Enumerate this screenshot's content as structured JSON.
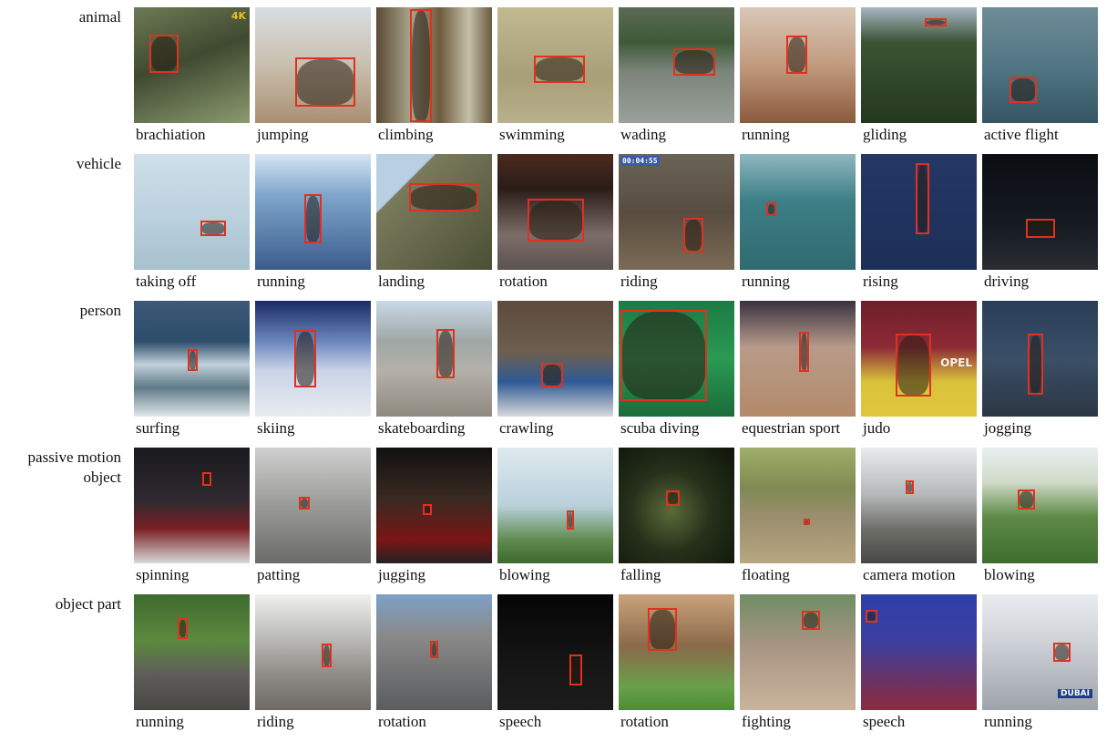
{
  "rows": [
    {
      "label": "animal",
      "cells": [
        {
          "caption": "brachiation"
        },
        {
          "caption": "jumping"
        },
        {
          "caption": "climbing"
        },
        {
          "caption": "swimming"
        },
        {
          "caption": "wading"
        },
        {
          "caption": "running"
        },
        {
          "caption": "gliding"
        },
        {
          "caption": "active flight"
        }
      ]
    },
    {
      "label": "vehicle",
      "cells": [
        {
          "caption": "taking off"
        },
        {
          "caption": "running"
        },
        {
          "caption": "landing"
        },
        {
          "caption": "rotation"
        },
        {
          "caption": "riding"
        },
        {
          "caption": "running"
        },
        {
          "caption": "rising"
        },
        {
          "caption": "driving"
        }
      ]
    },
    {
      "label": "person",
      "cells": [
        {
          "caption": "surfing"
        },
        {
          "caption": "skiing"
        },
        {
          "caption": "skateboarding"
        },
        {
          "caption": "crawling"
        },
        {
          "caption": "scuba diving"
        },
        {
          "caption": "equestrian sport"
        },
        {
          "caption": "judo"
        },
        {
          "caption": "jogging"
        }
      ]
    },
    {
      "label": "passive motion\nobject",
      "cells": [
        {
          "caption": "spinning"
        },
        {
          "caption": "patting"
        },
        {
          "caption": "jugging"
        },
        {
          "caption": "blowing"
        },
        {
          "caption": "falling"
        },
        {
          "caption": "floating"
        },
        {
          "caption": "camera motion"
        },
        {
          "caption": "blowing"
        }
      ]
    },
    {
      "label": "object part",
      "cells": [
        {
          "caption": "running"
        },
        {
          "caption": "riding"
        },
        {
          "caption": "rotation"
        },
        {
          "caption": "speech"
        },
        {
          "caption": "rotation"
        },
        {
          "caption": "fighting"
        },
        {
          "caption": "speech"
        },
        {
          "caption": "running"
        }
      ]
    }
  ],
  "overlays": {
    "badge_4k": "4K",
    "timestamp": "00:04:55",
    "opel_text": "OPEL",
    "dubai_text": "DUBAI"
  },
  "colors": {
    "bbox": "#e2301f",
    "background": "#ffffff"
  }
}
